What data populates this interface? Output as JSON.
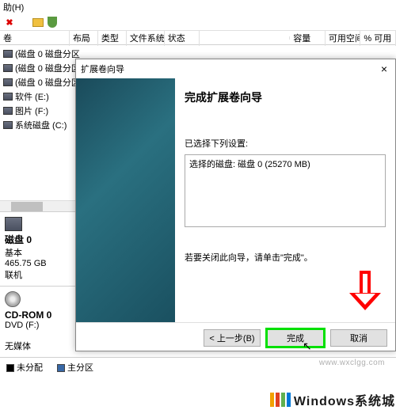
{
  "menu": {
    "help": "助(H)"
  },
  "table_headers": [
    "卷",
    "布局",
    "类型",
    "文件系统",
    "状态",
    "",
    "容量",
    "可用空间",
    "% 可用"
  ],
  "volumes": [
    "(磁盘 0 磁盘分区",
    "(磁盘 0 磁盘分区",
    "(磁盘 0 磁盘分区",
    "软件 (E:)",
    "图片 (F:)",
    "系统磁盘 (C:)"
  ],
  "disks": {
    "disk0": {
      "name": "磁盘 0",
      "type": "基本",
      "size": "465.75 GB",
      "status": "联机"
    },
    "cdrom": {
      "name": "CD-ROM 0",
      "letter": "DVD (F:)",
      "media": "无媒体"
    }
  },
  "legend": {
    "unalloc": "未分配",
    "primary": "主分区"
  },
  "wizard": {
    "title": "扩展卷向导",
    "heading": "完成扩展卷向导",
    "selected_label": "已选择下列设置:",
    "selected_text": "选择的磁盘: 磁盘 0 (25270 MB)",
    "finish_hint": "若要关闭此向导，请单击\"完成\"。",
    "btn_back": "< 上一步(B)",
    "btn_finish": "完成",
    "btn_cancel": "取消"
  },
  "watermark": "www.wxclgg.com",
  "brand": "Windows系统城"
}
